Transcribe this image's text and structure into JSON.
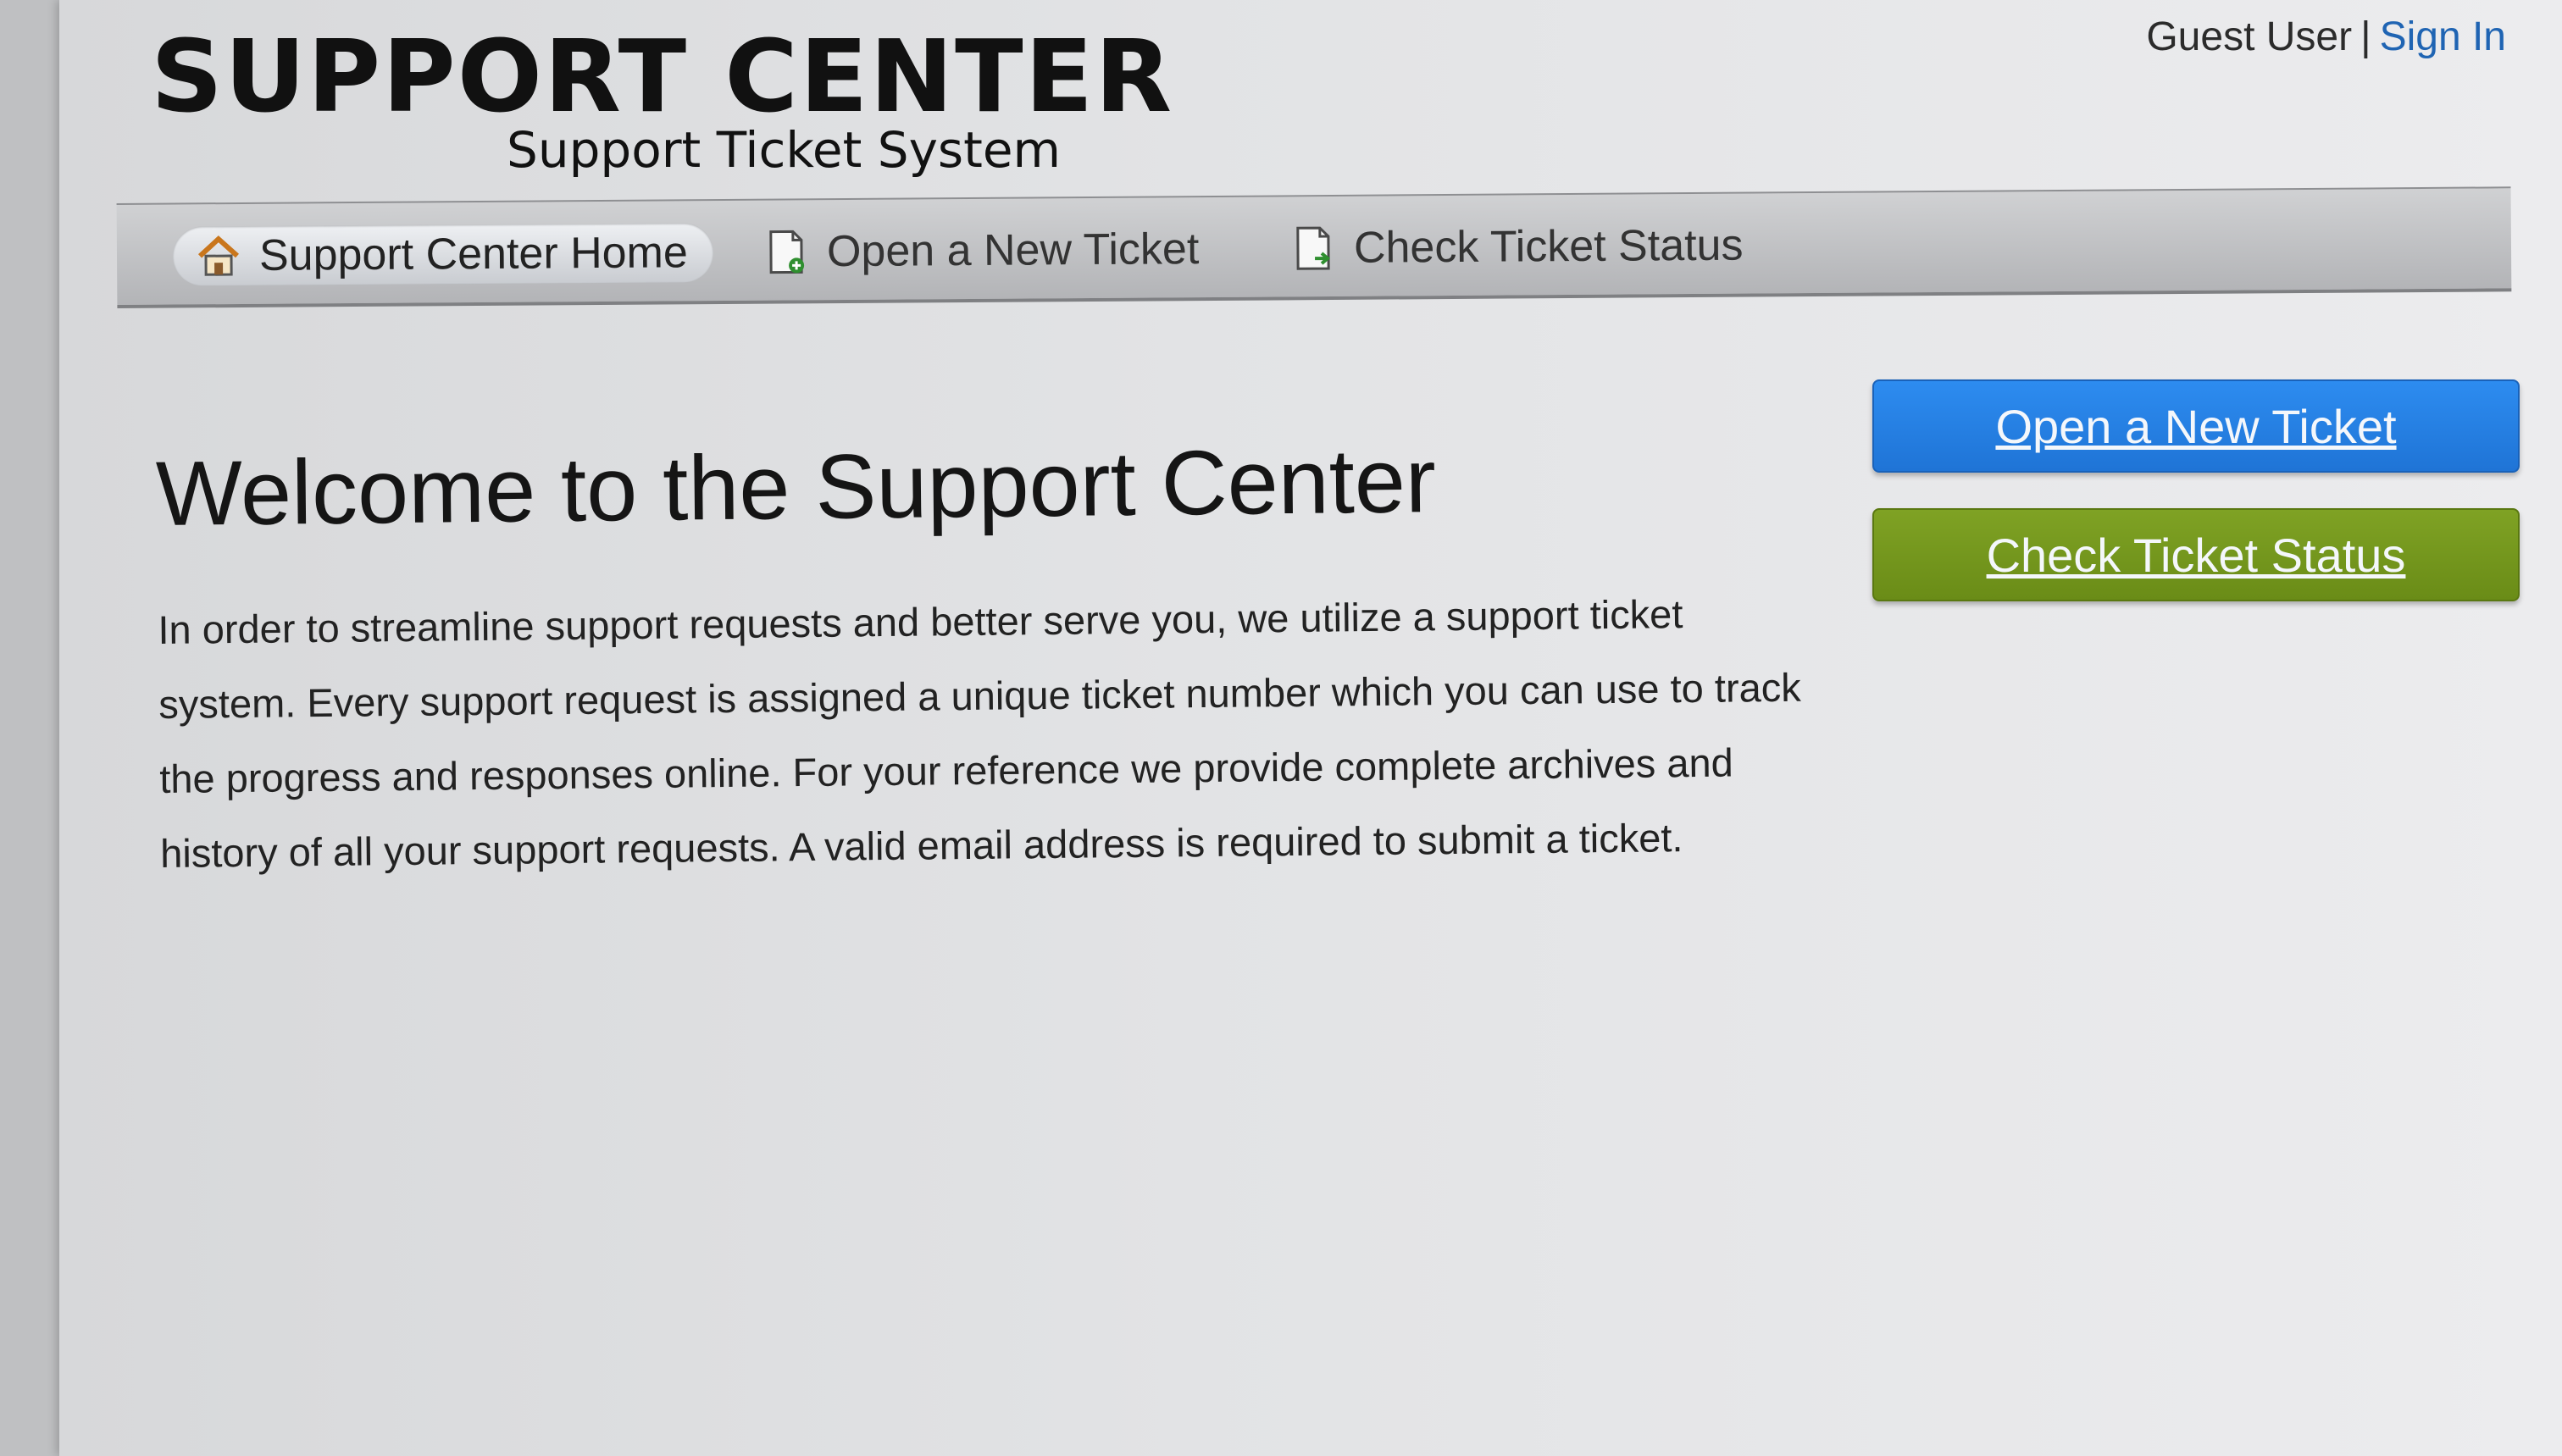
{
  "header": {
    "user_label": "Guest User",
    "separator": "|",
    "sign_in": "Sign In",
    "logo_title": "SUPPORT CENTER",
    "logo_subtitle": "Support Ticket System"
  },
  "nav": {
    "items": [
      {
        "label": "Support Center Home",
        "icon": "home-icon",
        "active": true
      },
      {
        "label": "Open a New Ticket",
        "icon": "new-ticket-icon",
        "active": false
      },
      {
        "label": "Check Ticket Status",
        "icon": "ticket-status-icon",
        "active": false
      }
    ]
  },
  "main": {
    "heading": "Welcome to the Support Center",
    "intro": "In order to streamline support requests and better serve you, we utilize a support ticket system. Every support request is assigned a unique ticket number which you can use to track the progress and responses online. For your reference we provide complete archives and history of all your support requests. A valid email address is required to submit a ticket."
  },
  "sidebar": {
    "open_ticket_button": "Open a New Ticket",
    "check_status_button": "Check Ticket Status"
  },
  "colors": {
    "link": "#1f64b3",
    "open_ticket_button": "#2a86e8",
    "check_status_button": "#73961c"
  }
}
